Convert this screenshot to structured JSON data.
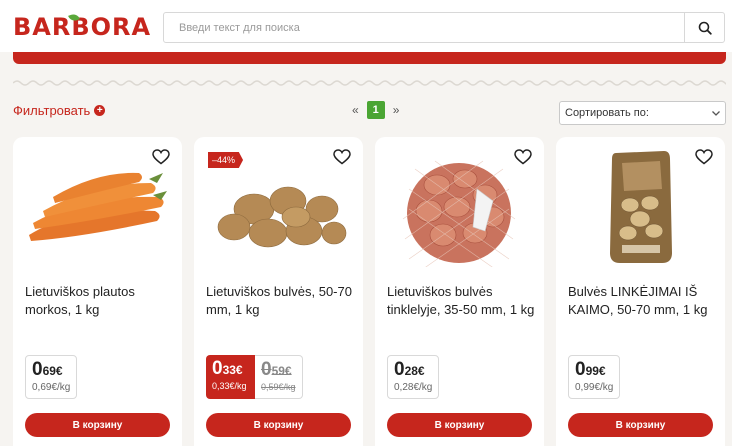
{
  "header": {
    "logo_text": "BARBORA",
    "search": {
      "placeholder": "Введи текст для поиска",
      "value": ""
    }
  },
  "toolbar": {
    "filter_label": "Фильтровать",
    "pager": {
      "prev": "«",
      "current_page": "1",
      "next": "»"
    },
    "sort_label": "Сортировать по:"
  },
  "colors": {
    "brand_red": "#c6261d",
    "accent_green": "#4aa533"
  },
  "products": [
    {
      "title": "Lietuviškos plautos morkos, 1 kg",
      "image_icon": "carrots-image",
      "price_int": "0",
      "price_frac": "69€",
      "unit_price": "0,69€/kg",
      "cart_label": "В корзину"
    },
    {
      "title": "Lietuviškos bulvės, 50-70 mm, 1 kg",
      "image_icon": "potatoes-image",
      "discount_badge": "–44%",
      "price_int": "0",
      "price_frac": "33€",
      "unit_price": "0,33€/kg",
      "old_price_int": "0",
      "old_price_frac": "59€",
      "old_unit_price": "0,59€/kg",
      "cart_label": "В корзину"
    },
    {
      "title": "Lietuviškos bulvės tinklelyje, 35-50 mm, 1 kg",
      "image_icon": "potatoes-net-bag-image",
      "price_int": "0",
      "price_frac": "28€",
      "unit_price": "0,28€/kg",
      "cart_label": "В корзину"
    },
    {
      "title": "Bulvės LINKĖJIMAI IŠ KAIMO, 50-70 mm, 1 kg",
      "image_icon": "potato-bag-image",
      "price_int": "0",
      "price_frac": "99€",
      "unit_price": "0,99€/kg",
      "cart_label": "В корзину"
    }
  ]
}
